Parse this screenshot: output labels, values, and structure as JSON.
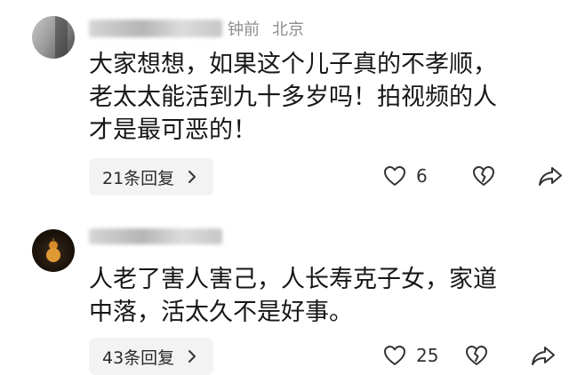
{
  "comments": [
    {
      "time": "钟前",
      "location": "北京",
      "text_lines": [
        "大家想想，如果这个儿子真的不孝顺，",
        "老太太能活到九十多岁吗！拍视频的人",
        "才是最可恶的！"
      ],
      "replies_label": "21条回复",
      "like_count": "6"
    },
    {
      "text_lines": [
        "人老了害人害己，人长寿克子女，家道",
        "中落，活太久不是好事。"
      ],
      "replies_label": "43条回复",
      "like_count": "25"
    }
  ],
  "icons": {
    "like": "heart-outline-icon",
    "dislike": "broken-heart-icon",
    "share": "share-arrow-icon",
    "chevron": "chevron-right-icon"
  },
  "colors": {
    "background": "#ffffff",
    "meta_text": "#8d8d8d",
    "pill_bg": "#f3f3f3"
  }
}
